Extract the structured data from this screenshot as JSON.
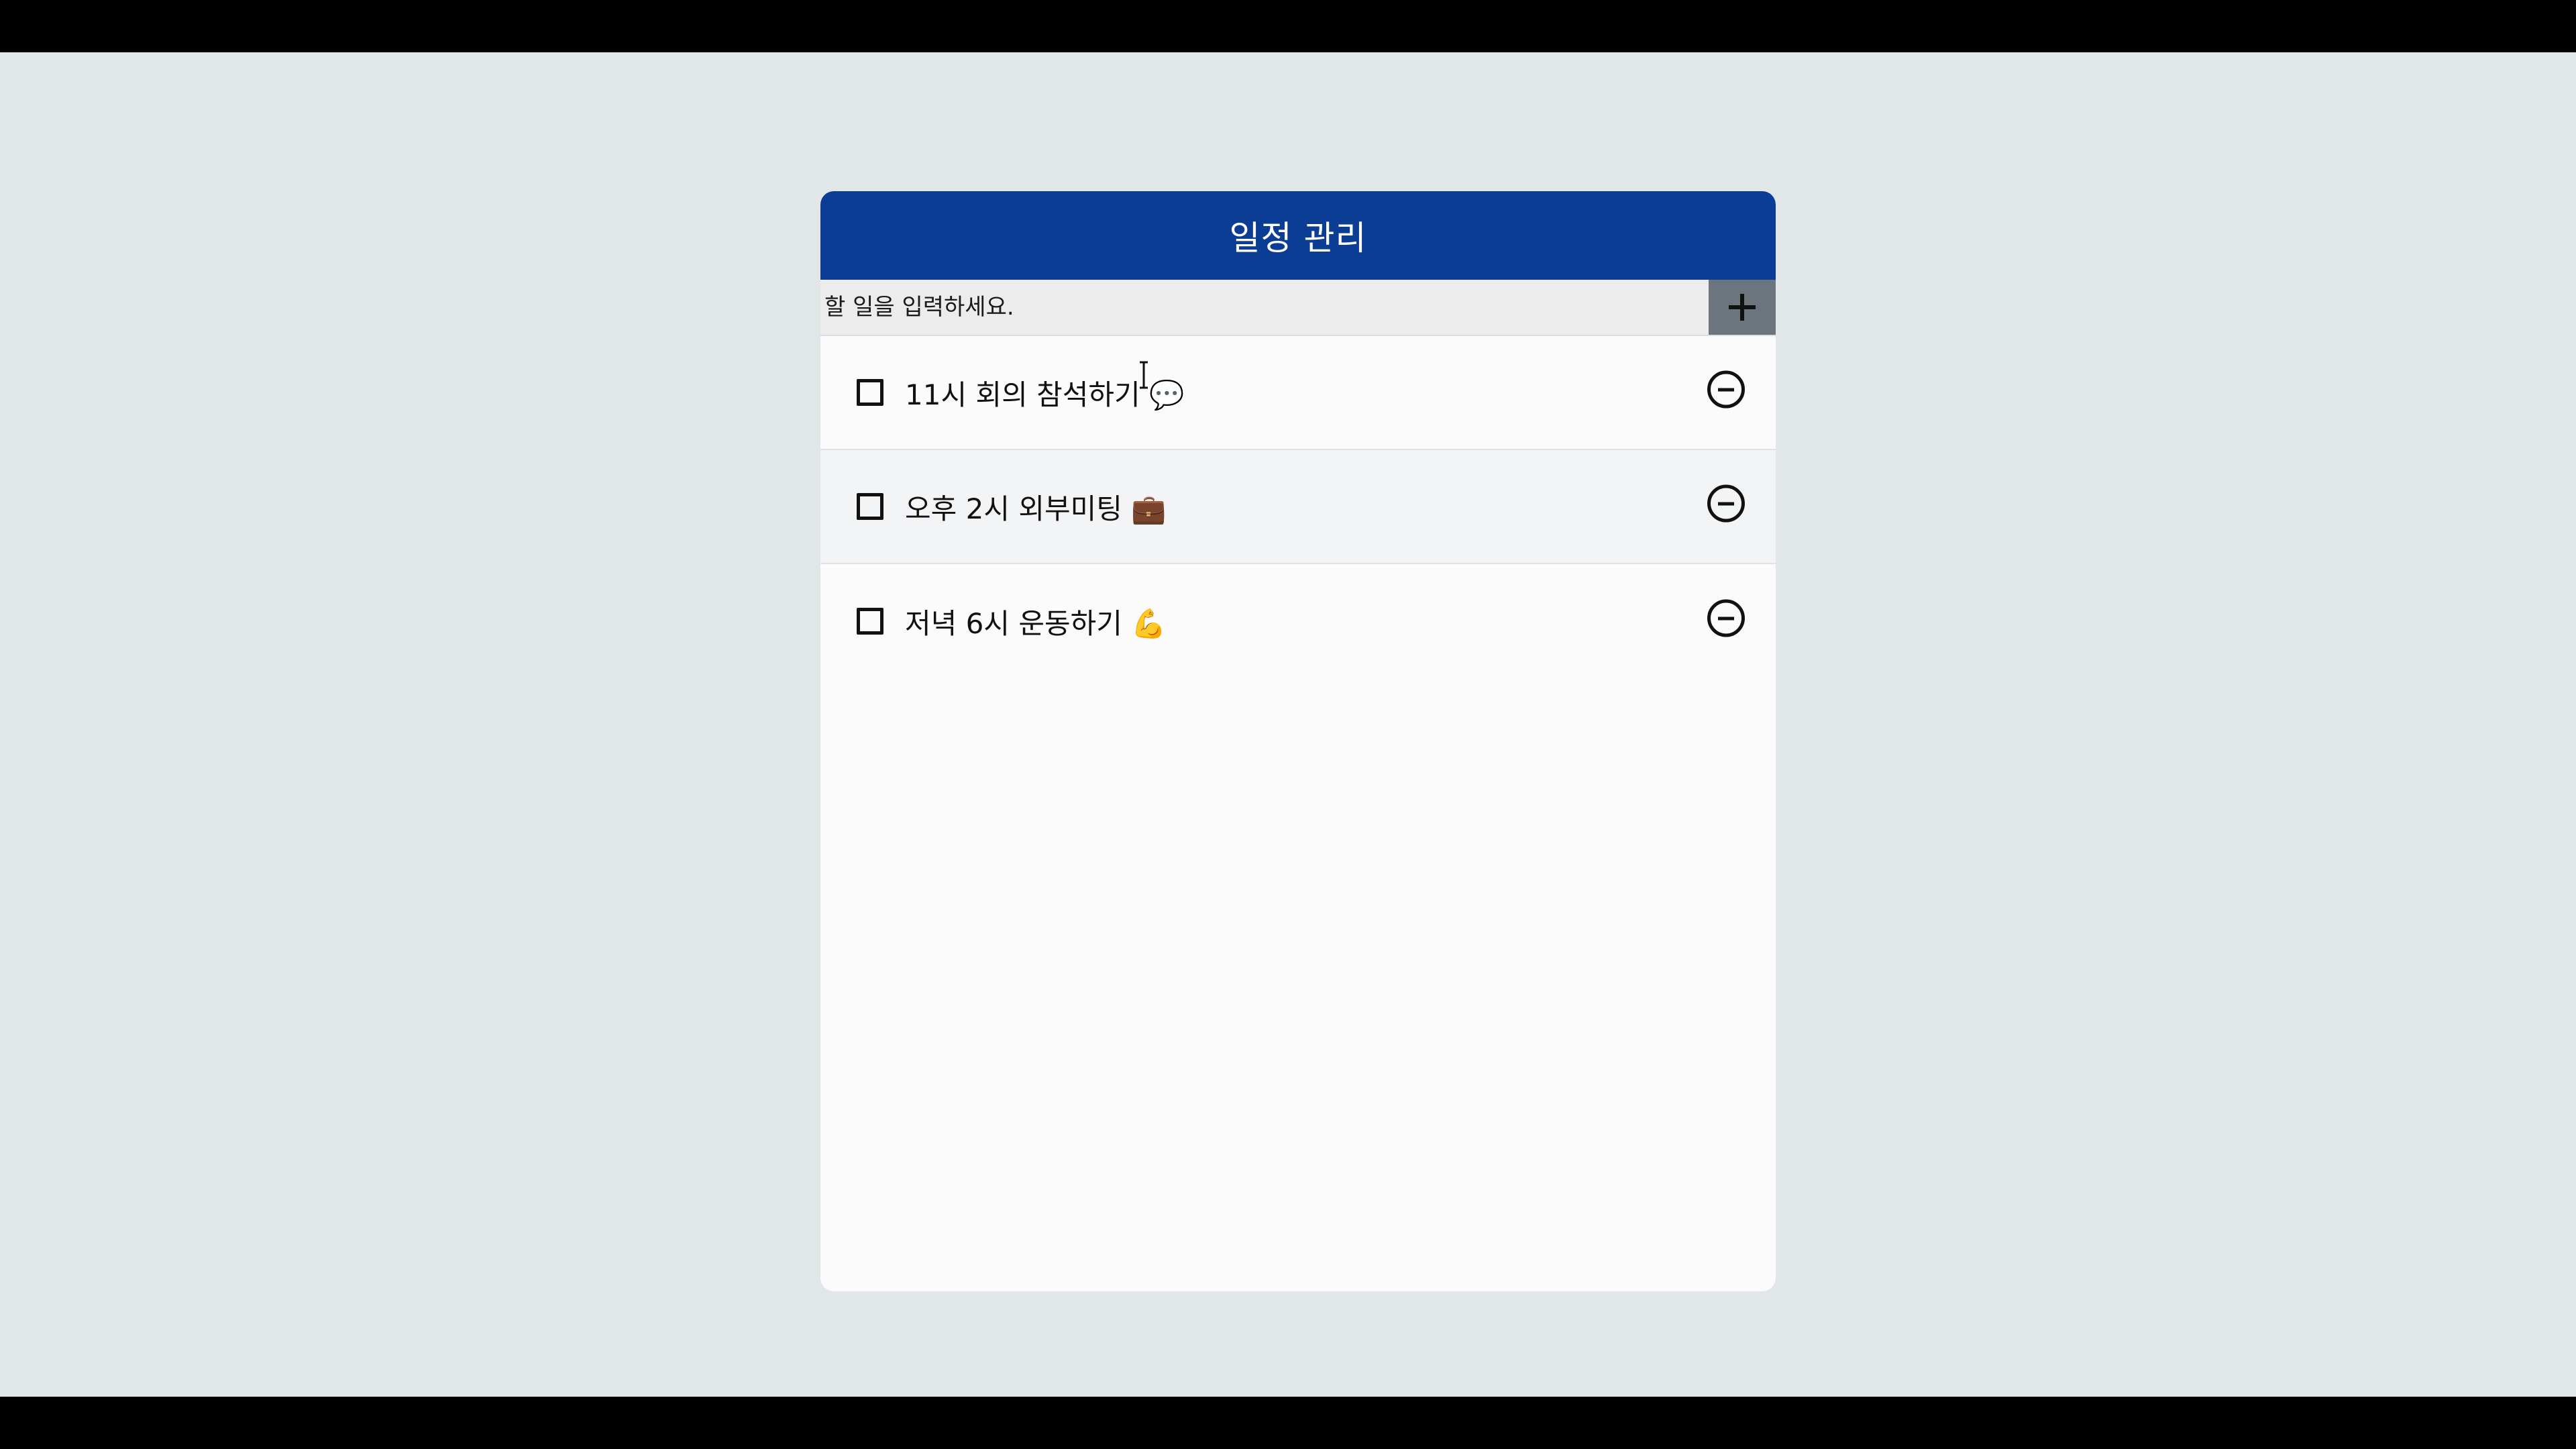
{
  "app": {
    "title": "일정 관리"
  },
  "input": {
    "placeholder": "할 일을 입력하세요.",
    "value": "",
    "add_button_icon": "plus-icon"
  },
  "todos": [
    {
      "text": "11시 회의 참석하기 💬",
      "checked": false
    },
    {
      "text": "오후 2시 외부미팅 💼",
      "checked": false
    },
    {
      "text": "저녁 6시 운동하기 💪",
      "checked": false
    }
  ],
  "colors": {
    "header": "#0b3d94",
    "background": "#e1e6e9",
    "card": "#fbfbfb",
    "add_button": "#6c757d"
  }
}
